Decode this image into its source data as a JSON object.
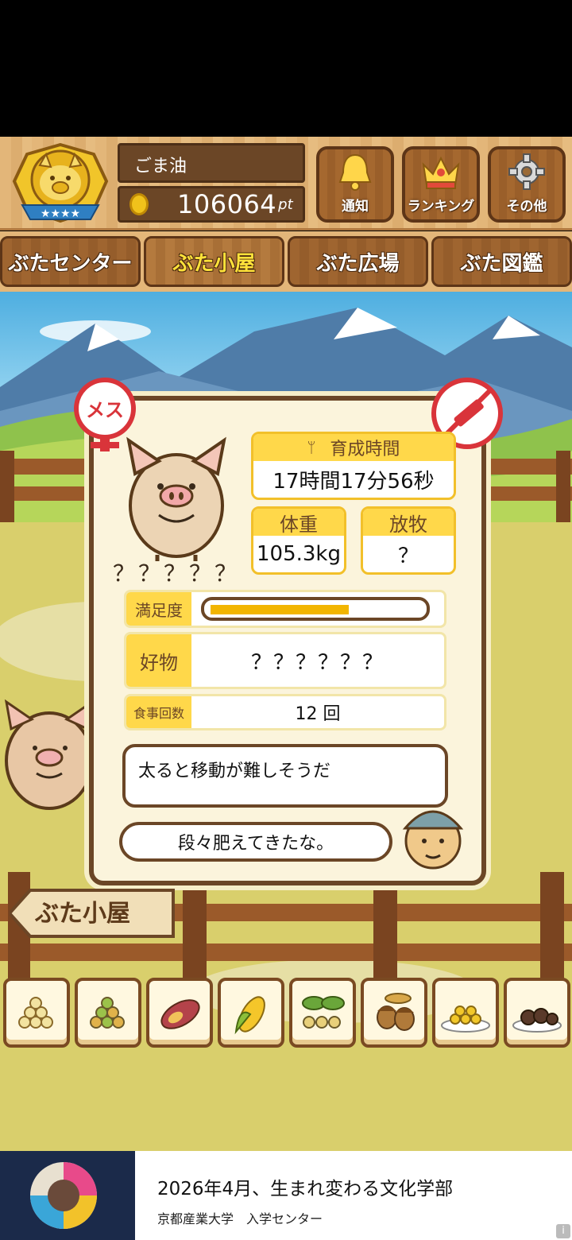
{
  "header": {
    "player_name": "ごま油",
    "points_value": "106064",
    "points_unit": "pt",
    "buttons": [
      {
        "label": "通知",
        "icon": "bell-icon"
      },
      {
        "label": "ランキング",
        "icon": "crown-icon"
      },
      {
        "label": "その他",
        "icon": "gear-icon"
      }
    ]
  },
  "tabs": [
    {
      "label": "ぶたセンター",
      "active": false
    },
    {
      "label": "ぶた小屋",
      "active": true
    },
    {
      "label": "ぶた広場",
      "active": false
    },
    {
      "label": "ぶた図鑑",
      "active": false
    }
  ],
  "pig_info": {
    "gender_badge": "メス",
    "name": "？？？？？",
    "growth_time_label": "育成時間",
    "growth_time_value": "17時間17分56秒",
    "weight_label": "体重",
    "weight_value": "105.3kg",
    "grazing_label": "放牧",
    "grazing_value": "？",
    "satisfaction_label": "満足度",
    "satisfaction_level": 0.66,
    "favorite_label": "好物",
    "favorite_value": "？？？？？？",
    "meals_label": "食事回数",
    "meals_value": "12 回",
    "comment_1": "太ると移動が難しそうだ",
    "comment_2": "段々肥えてきたな。"
  },
  "sign_label": "ぶた小屋",
  "food_items": [
    "grain-icon",
    "mixed-grain-icon",
    "sweet-potato-icon",
    "corn-icon",
    "beans-leaves-icon",
    "acorn-icon",
    "soybean-plate-icon",
    "meatball-plate-icon"
  ],
  "ad": {
    "title": "2026年4月、生まれ変わる文化学部",
    "subtitle": "京都産業大学　入学センター",
    "info": "i"
  },
  "colors": {
    "wood": "#e3b679",
    "dark_wood": "#6b4626",
    "accent_yellow": "#ffd84a",
    "tab_active_text": "#ffe23a"
  }
}
